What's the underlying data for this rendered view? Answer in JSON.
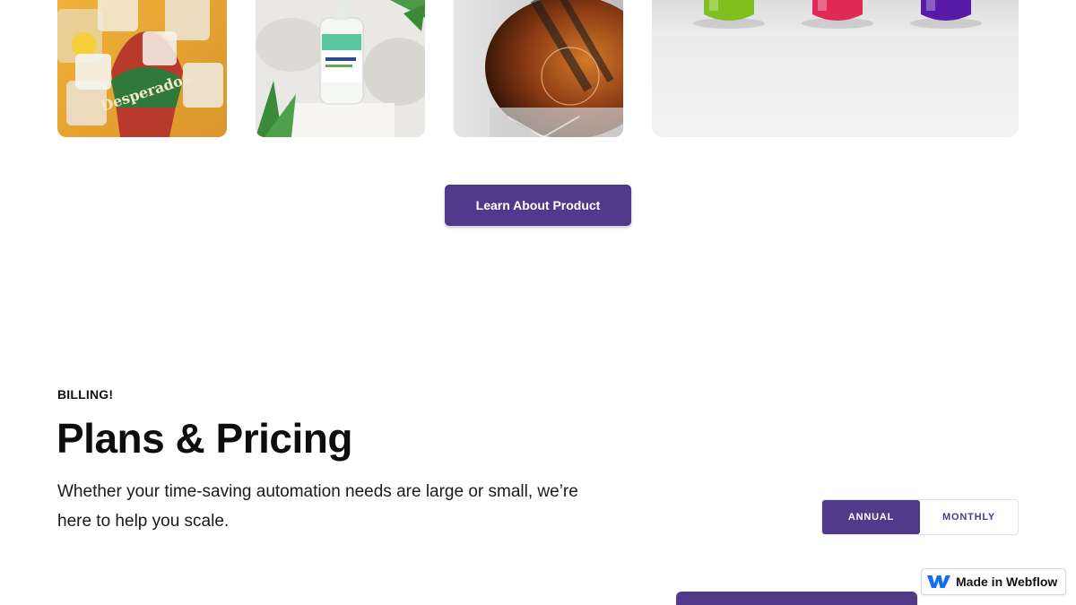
{
  "gallery": {
    "tiles": [
      {
        "subject": "beer-bottle-ice-cubes",
        "label": "Desperados"
      },
      {
        "subject": "cleaner-bottle-on-podium"
      },
      {
        "subject": "glass-decanter"
      },
      {
        "subject": "colored-bottles"
      }
    ]
  },
  "cta": {
    "label": "Learn About Product"
  },
  "billing": {
    "eyebrow": "BILLING!",
    "title": "Plans & Pricing",
    "subtitle": "Whether your time-saving automation needs are large or small, we’re here to help you scale."
  },
  "toggle": {
    "options": [
      {
        "label": "ANNUAL",
        "active": true
      },
      {
        "label": "MONTHLY",
        "active": false
      }
    ]
  },
  "badge": {
    "label": "Made in Webflow",
    "icon": "webflow-logo-icon"
  },
  "colors": {
    "brand": "#523a8a",
    "webflow": "#146ef5"
  }
}
